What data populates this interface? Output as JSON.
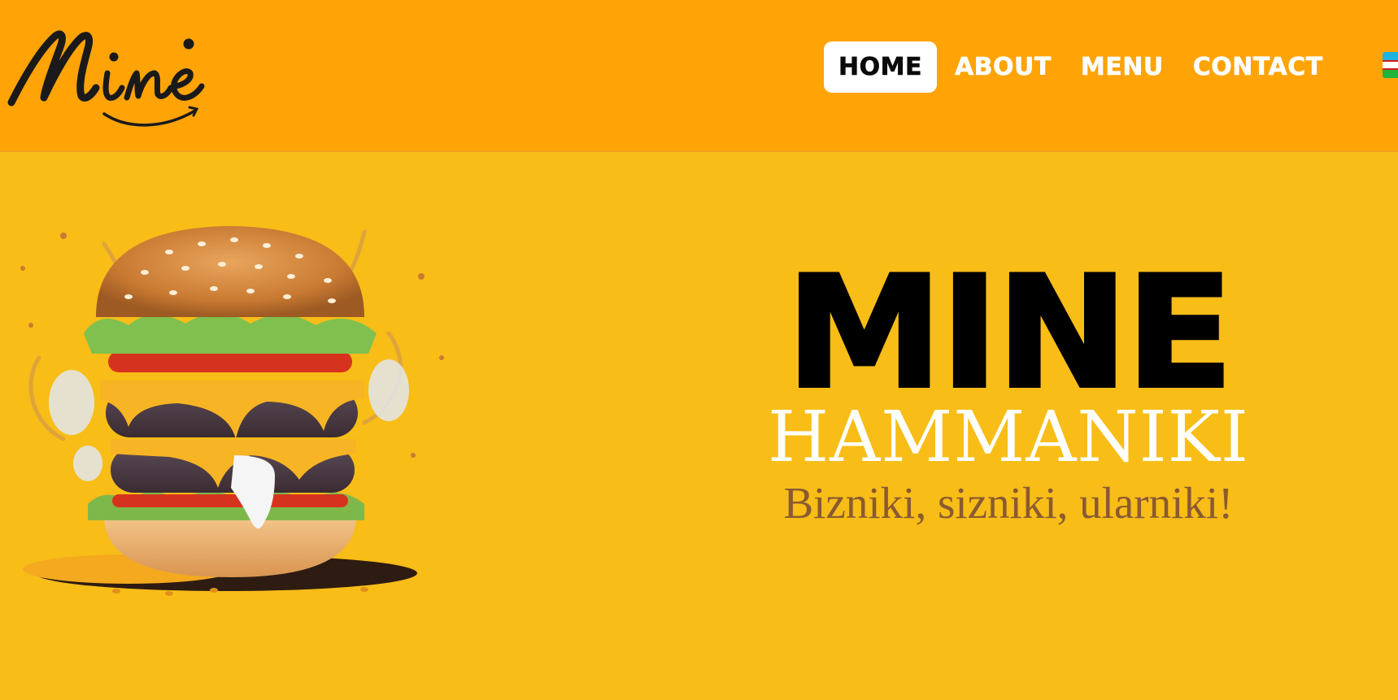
{
  "brand": {
    "logo_text": "Minė"
  },
  "nav": {
    "items": [
      {
        "label": "HOME",
        "active": true
      },
      {
        "label": "ABOUT",
        "active": false
      },
      {
        "label": "MENU",
        "active": false
      },
      {
        "label": "CONTACT",
        "active": false
      }
    ],
    "language_flag": "uzbekistan-flag-icon"
  },
  "hero": {
    "title": "MINE",
    "subtitle": "HAMMANIKI",
    "tagline": "Bizniki, sizniki, ularniki!",
    "image": "burger-image"
  },
  "colors": {
    "header_bg": "#ffa307",
    "page_bg": "#f8bd17",
    "tagline": "#8a5a31"
  }
}
